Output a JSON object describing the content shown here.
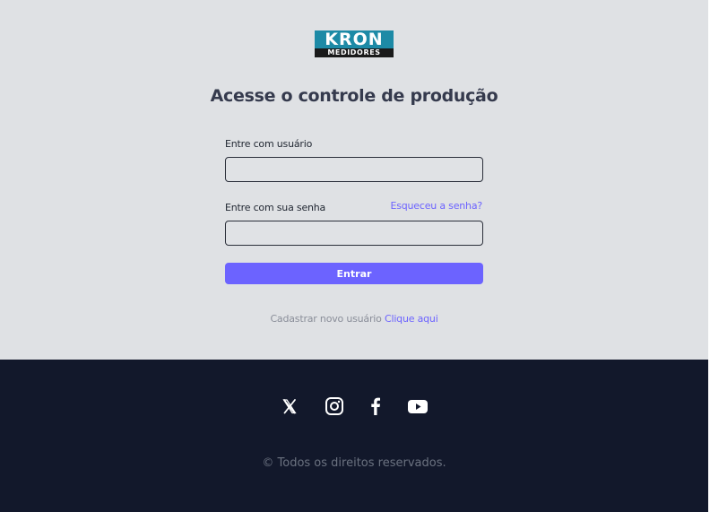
{
  "logo": {
    "top_text": "KRON",
    "bottom_text": "MEDIDORES"
  },
  "login": {
    "title": "Acesse o controle de produção",
    "user_label": "Entre com usuário",
    "user_value": "",
    "password_label": "Entre com sua senha",
    "password_value": "",
    "forgot_link": "Esqueceu a senha?",
    "submit_label": "Entrar",
    "register_text": "Cadastrar novo usuário",
    "register_link": "Clique aqui"
  },
  "footer": {
    "social_icons": [
      "x-icon",
      "instagram-icon",
      "facebook-icon",
      "youtube-icon"
    ],
    "copyright": "© Todos os direitos reservados."
  },
  "colors": {
    "background": "#dfe1e4",
    "accent": "#6c63ff",
    "footer": "#12182b",
    "logo_blue": "#1d8aa6"
  }
}
